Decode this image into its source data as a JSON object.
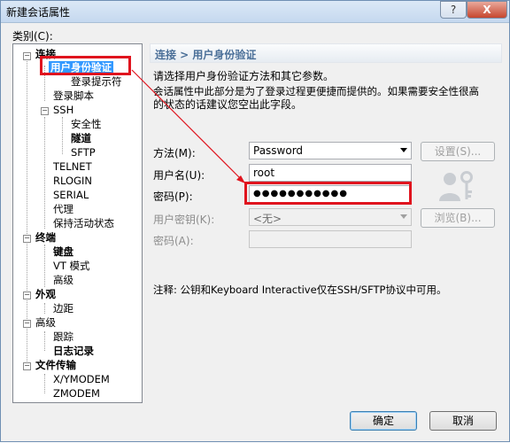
{
  "window": {
    "title": "新建会话属性",
    "help": "?",
    "close": "X"
  },
  "category_label": "类别(C):",
  "tree": {
    "connection": "连接",
    "user_auth": "用户身份验证",
    "login_prompts": "登录提示符",
    "login_script": "登录脚本",
    "ssh": "SSH",
    "security": "安全性",
    "tunnel": "隧道",
    "sftp": "SFTP",
    "telnet": "TELNET",
    "rlogin": "RLOGIN",
    "serial": "SERIAL",
    "proxy": "代理",
    "keepalive": "保持活动状态",
    "terminal": "终端",
    "keyboard": "键盘",
    "vt_mode": "VT 模式",
    "advanced_t": "高级",
    "appearance": "外观",
    "margin": "边距",
    "advanced": "高级",
    "trace": "跟踪",
    "log": "日志记录",
    "file_transfer": "文件传输",
    "xymodem": "X/YMODEM",
    "zmodem": "ZMODEM"
  },
  "panel": {
    "breadcrumb": "连接 > 用户身份验证",
    "desc1": "请选择用户身份验证方法和其它参数。",
    "desc2": "会话属性中此部分是为了登录过程更便捷而提供的。如果需要安全性很高",
    "desc3": "的状态的话建议您空出此字段。",
    "method_label": "方法(M):",
    "method_value": "Password",
    "settings_button": "设置(S)...",
    "username_label": "用户名(U):",
    "username_value": "root",
    "password_label": "密码(P):",
    "password_value": "●●●●●●●●●●●",
    "user_key_label": "用户密钥(K):",
    "user_key_value": "<无>",
    "browse_button": "浏览(B)...",
    "passphrase_label": "密码(A):",
    "note": "注释: 公钥和Keyboard Interactive仅在SSH/SFTP协议中可用。"
  },
  "footer": {
    "ok": "确定",
    "cancel": "取消"
  },
  "colors": {
    "annotation": "#e0141e",
    "selection": "#3399ff",
    "header_text": "#4a6f98"
  }
}
